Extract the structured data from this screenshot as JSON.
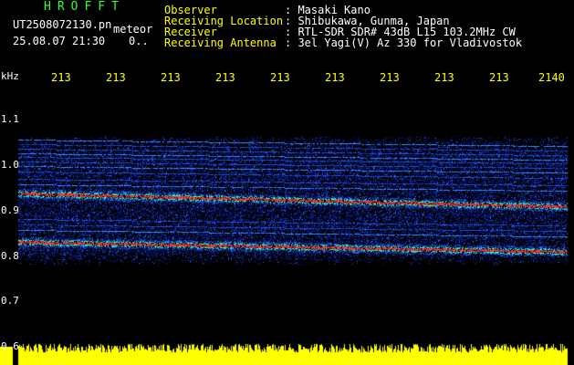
{
  "header": {
    "title": "HROFFT",
    "filename": "UT2508072130.pn",
    "filename_tag": "meteor",
    "datetime": "25.08.07 21:30",
    "counter": "0..",
    "labels": {
      "observer": "Observer",
      "location": "Receiving Location",
      "receiver": "Receiver",
      "antenna": "Receiving Antenna"
    },
    "values": {
      "observer": ": Masaki Kano",
      "location": ": Shibukawa, Gunma, Japan",
      "receiver": ": RTL-SDR SDR# 43dB L15 103.2MHz CW",
      "antenna": ": 3el Yagi(V) Az 330 for Vladivostok"
    }
  },
  "axis": {
    "unit": "kHz",
    "y_labels": [
      "1.1",
      "1.0",
      "0.9",
      "0.8",
      "0.7",
      "0.6"
    ],
    "x_labels": [
      "213",
      "213",
      "213",
      "213",
      "213",
      "213",
      "213",
      "213",
      "213",
      "2140"
    ]
  },
  "colors": {
    "background": "#000000",
    "axis_text": "#ffff00",
    "header_values": "#ffffff",
    "title": "#33ff33",
    "bottom_band": "#ffff00",
    "echo_line": "#ff3333"
  }
}
